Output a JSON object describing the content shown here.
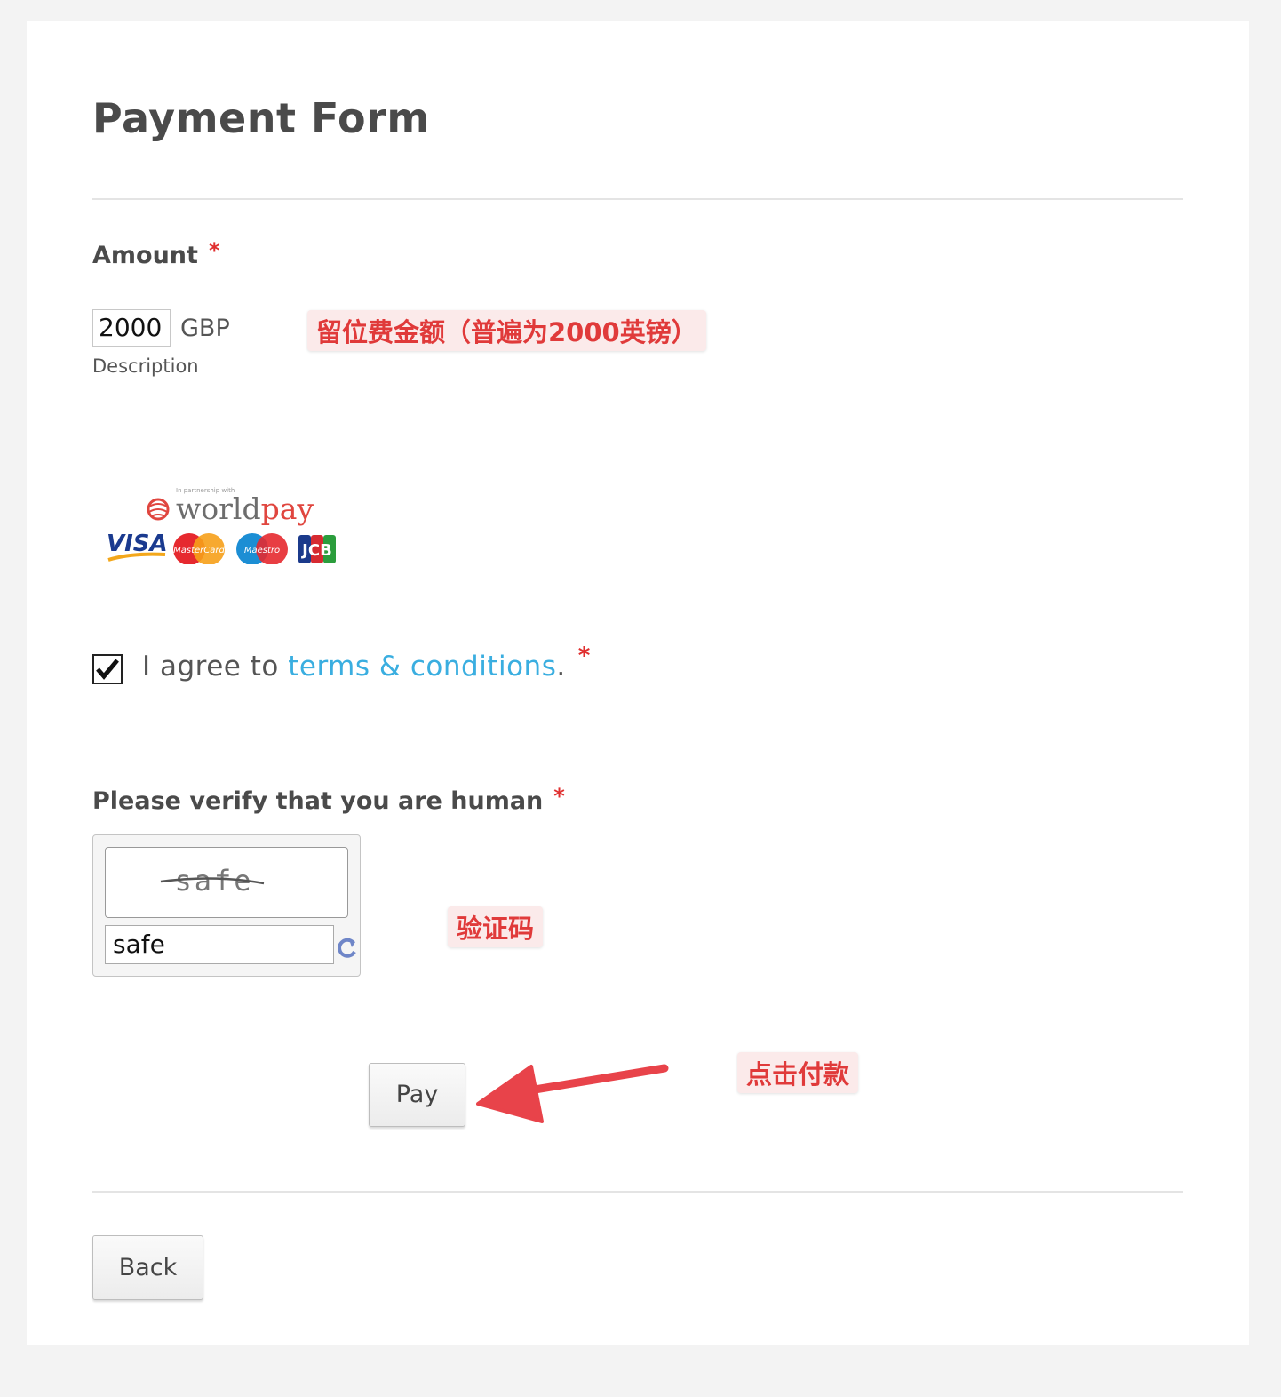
{
  "form": {
    "title": "Payment Form",
    "amount_label": "Amount",
    "required_mark": "*",
    "amount_value": "2000",
    "currency": "GBP",
    "description_label": "Description",
    "payment_logo": {
      "partner_text": "In partnership with",
      "brand": "worldpay",
      "cards": [
        "VISA",
        "MasterCard",
        "Maestro",
        "JCB"
      ]
    },
    "agree_prefix": "I agree to ",
    "terms_link": "terms & conditions",
    "agree_suffix": ".",
    "agree_checked": true,
    "verify_label": "Please verify that you are human",
    "captcha_image_text": "safe",
    "captcha_input_value": "safe",
    "pay_button": "Pay",
    "back_button": "Back"
  },
  "annotations": {
    "amount_note": "留位费金额（普遍为2000英镑）",
    "captcha_note": "验证码",
    "pay_note": "点击付款"
  },
  "colors": {
    "accent_link": "#3aaee0",
    "required": "#e02f2f",
    "annotation_text": "#e03a3a",
    "annotation_bg": "#fbeaea",
    "arrow": "#e8434a"
  },
  "icons": [
    "check-icon",
    "refresh-icon",
    "arrow-icon"
  ]
}
